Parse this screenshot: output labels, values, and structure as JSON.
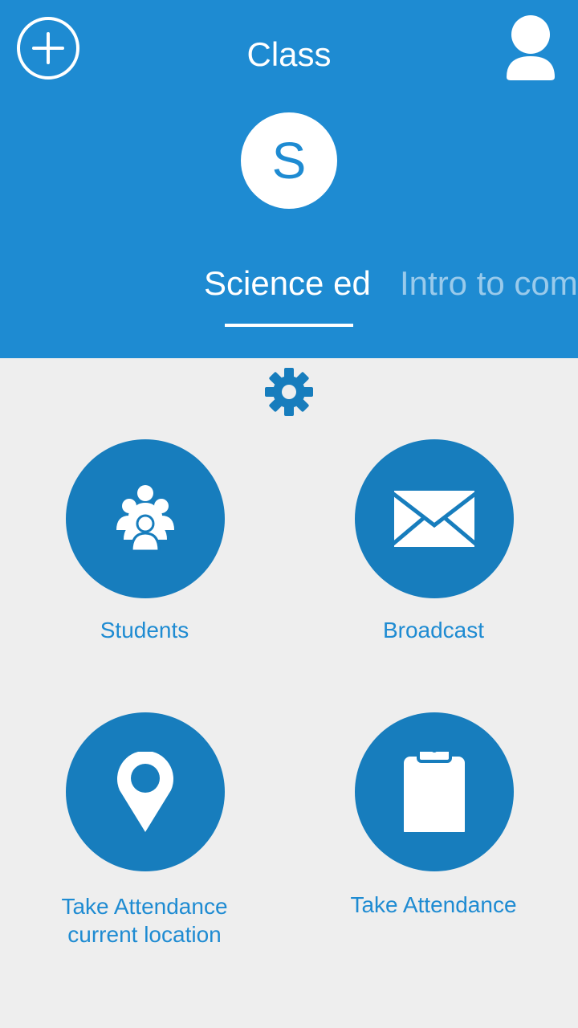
{
  "app": {
    "title": "Class",
    "accent_color": "#1e8bd2",
    "icon_circle_color": "#177dbd",
    "background_color": "#eeeeee"
  },
  "header": {
    "add_icon": "plus-circle-icon",
    "profile_icon": "user-icon",
    "class_avatar_letter": "S"
  },
  "tabs": [
    {
      "label": "Science ed",
      "active": true
    },
    {
      "label": "Intro to com",
      "active": false
    }
  ],
  "settings": {
    "icon": "gear-icon"
  },
  "actions": [
    {
      "label": "Students",
      "icon": "group-icon"
    },
    {
      "label": "Broadcast",
      "icon": "envelope-icon"
    },
    {
      "label": "Take Attendance\ncurrent location",
      "icon": "location-pin-icon"
    },
    {
      "label": "Take Attendance",
      "icon": "clipboard-icon"
    }
  ]
}
